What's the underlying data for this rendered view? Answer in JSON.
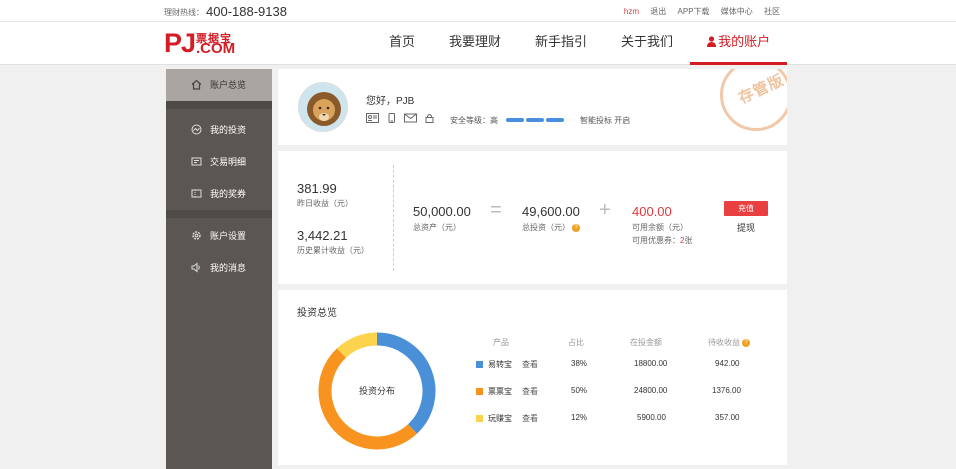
{
  "topbar": {
    "hotline_label": "理财热线：",
    "hotline_number": "400-188-9138",
    "links": [
      "hzm",
      "退出",
      "APP下载",
      "媒体中心",
      "社区"
    ]
  },
  "logo": {
    "letters": "PJ",
    "cn": "票据宝",
    "dotcom": ".COM"
  },
  "nav": {
    "items": [
      {
        "label": "首页"
      },
      {
        "label": "我要理财"
      },
      {
        "label": "新手指引"
      },
      {
        "label": "关于我们"
      },
      {
        "label": "我的账户"
      }
    ]
  },
  "sidebar": {
    "items": [
      {
        "label": "账户总览",
        "icon": "home-icon"
      },
      {
        "label": "我的投资",
        "icon": "invest-icon"
      },
      {
        "label": "交易明细",
        "icon": "detail-icon"
      },
      {
        "label": "我的奖券",
        "icon": "coupon-icon"
      },
      {
        "label": "账户设置",
        "icon": "gear-icon"
      },
      {
        "label": "我的消息",
        "icon": "speaker-icon"
      }
    ]
  },
  "profile": {
    "greeting": "您好，PJB",
    "security_label": "安全等级：高",
    "smart_bid": "智能投标 开启",
    "stamp": "存管版"
  },
  "summary": {
    "yesterday_value": "381.99",
    "yesterday_label": "昨日收益（元）",
    "history_value": "3,442.21",
    "history_label": "历史累计收益（元）",
    "total_value": "50,000.00",
    "total_label": "总资产（元）",
    "equals": "=",
    "invest_value": "49,600.00",
    "invest_label": "总投资（元）",
    "plus": "+",
    "available_value": "400.00",
    "available_label": "可用余额（元）",
    "coupon_label": "可用优惠券：",
    "coupon_count": "2",
    "coupon_unit": "张",
    "recharge": "充值",
    "withdraw": "提现"
  },
  "overview": {
    "title": "投资总览",
    "donut_label": "投资分布",
    "headers": [
      "产品",
      "占比",
      "在投金额",
      "待收收益"
    ],
    "rows": [
      {
        "product": "易转宝",
        "view": "查看",
        "ratio": "38%",
        "amount": "18800.00",
        "income": "942.00",
        "color": "#4a90d9"
      },
      {
        "product": "票票宝",
        "view": "查看",
        "ratio": "50%",
        "amount": "24800.00",
        "income": "1376.00",
        "color": "#f7931e"
      },
      {
        "product": "玩赚宝",
        "view": "查看",
        "ratio": "12%",
        "amount": "5900.00",
        "income": "357.00",
        "color": "#fcd34d"
      }
    ]
  },
  "chart_data": {
    "type": "pie",
    "title": "",
    "categories": [
      "易转宝",
      "票票宝",
      "玩赚宝"
    ],
    "values": [
      38,
      50,
      12
    ],
    "colors": [
      "#4a90d9",
      "#f7931e",
      "#fcd34d"
    ]
  }
}
